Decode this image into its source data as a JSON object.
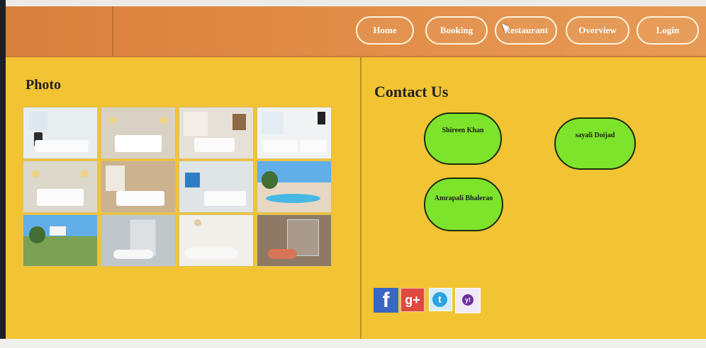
{
  "header": {
    "nav": [
      "Home",
      "Booking",
      "Restaurant",
      "Overview",
      "Login"
    ]
  },
  "sections": {
    "photo_title": "Photo",
    "contact_title": "Contact Us"
  },
  "gallery": {
    "items": [
      "bedroom-icon",
      "bedroom-icon",
      "bedroom-icon",
      "bedroom-icon",
      "bedroom-icon",
      "bedroom-icon",
      "bedroom-icon",
      "pool-icon",
      "garden-icon",
      "bathroom-icon",
      "bathroom-icon",
      "bathroom-icon"
    ]
  },
  "contacts": [
    "Shireen Khan",
    "sayali Doijad",
    "Amrapali Bhalerao"
  ],
  "social": {
    "facebook_text": "f",
    "google_plus_text": "g+",
    "twitter_text": "t",
    "yahoo_text": "y!"
  },
  "colors": {
    "header_orange": "#e08a45",
    "page_yellow": "#f2c333",
    "contact_green": "#7de42b"
  }
}
